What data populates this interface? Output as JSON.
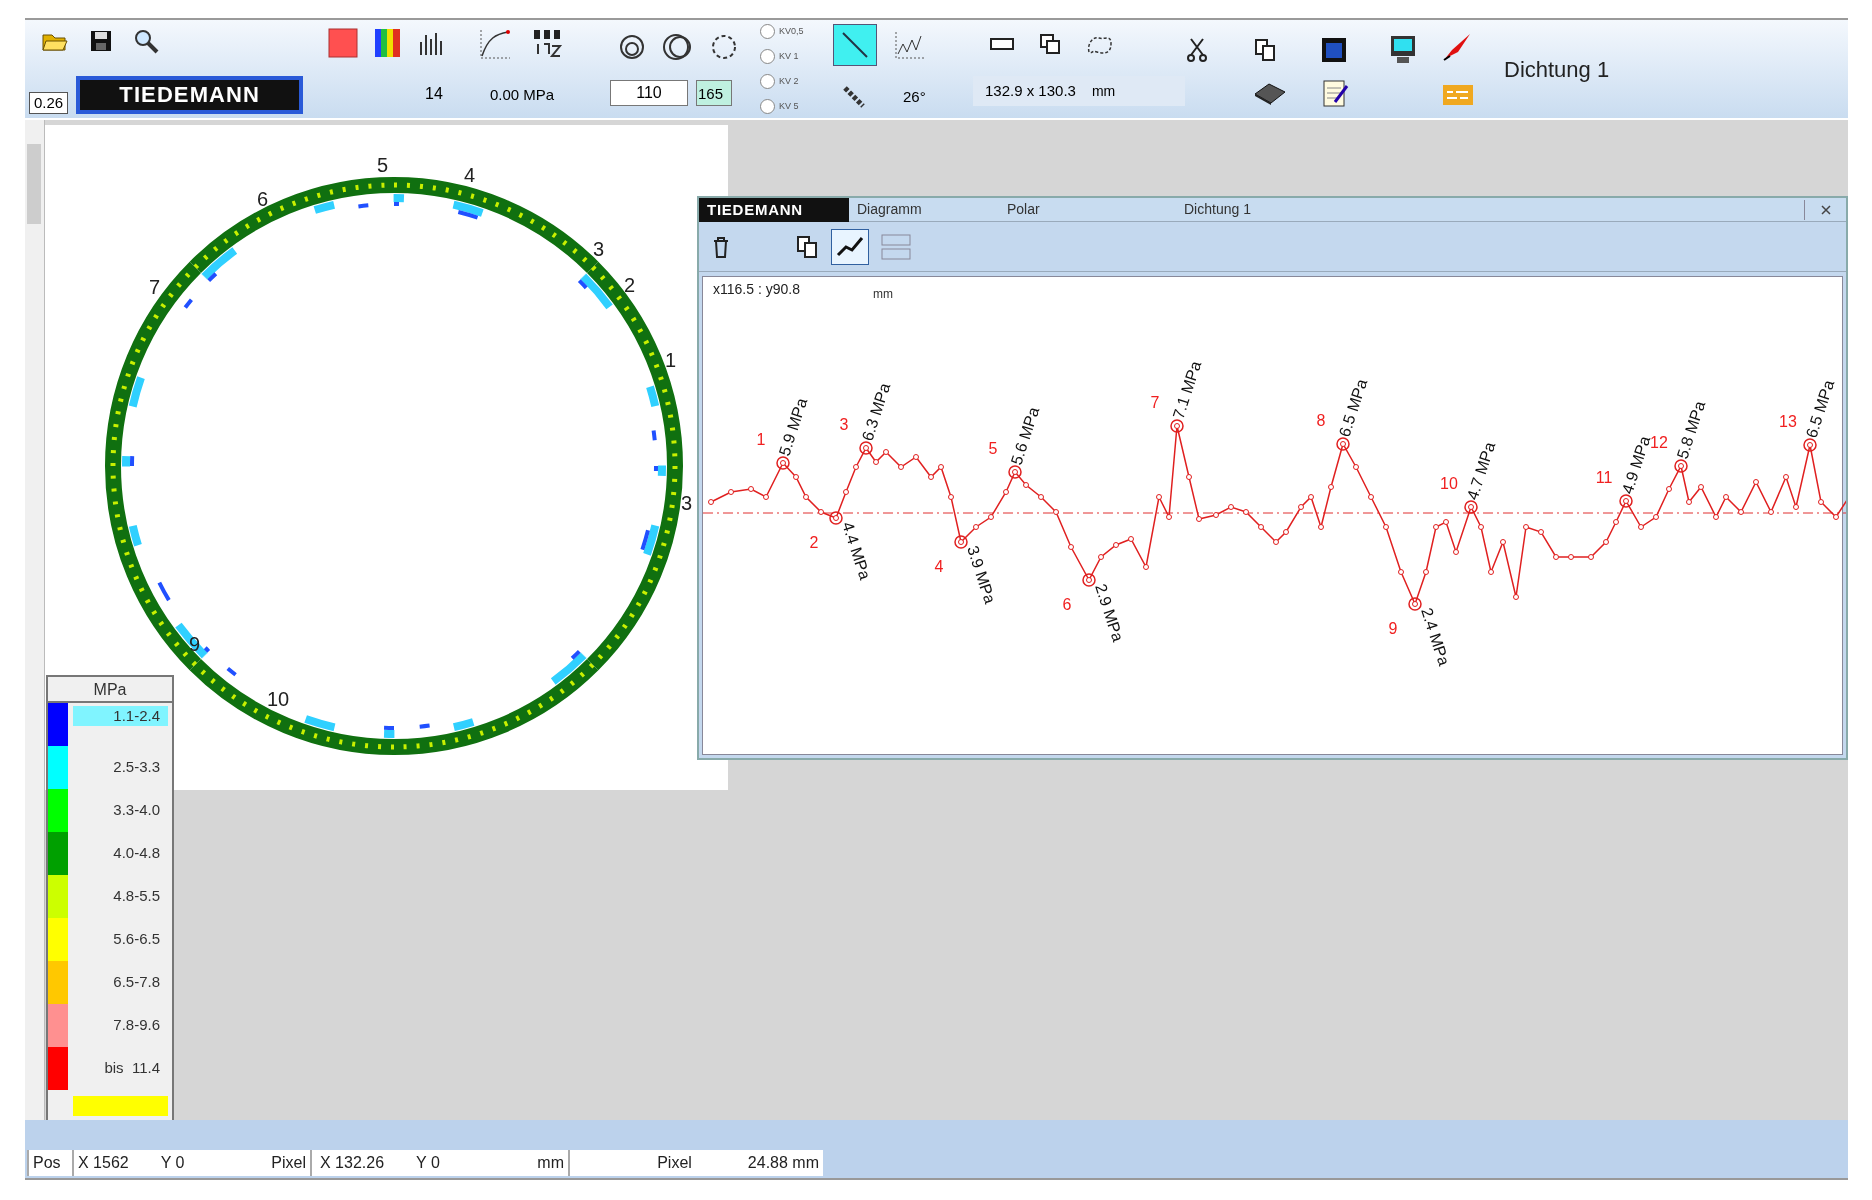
{
  "toolbar": {
    "zoom_value": "0.26",
    "logo": "TIEDEMANN",
    "count": "14",
    "pressure": "0.00 MPa",
    "threshold_value": "110",
    "threshold_value_2": "165",
    "radio_options": [
      {
        "label": "KV0,5",
        "selected": false
      },
      {
        "label": "KV 1",
        "selected": false
      },
      {
        "label": "KV 2",
        "selected": false
      },
      {
        "label": "KV 5",
        "selected": false
      }
    ],
    "line_tool": {
      "pressed": true
    },
    "angle": "26°",
    "dimensions": "132.9 x 130.3",
    "dimensions_unit": "mm",
    "title": "Dichtung 1"
  },
  "ring": {
    "labels": [
      "5",
      "4",
      "6",
      "3",
      "2",
      "7",
      "1",
      "3",
      "9",
      "10"
    ]
  },
  "legend": {
    "unit": "MPa",
    "items": [
      {
        "label": "1.1-2.4",
        "color": "#0000ff",
        "selected": true
      },
      {
        "label": "2.5-3.3",
        "color": "#00ffff",
        "selected": false
      },
      {
        "label": "3.3-4.0",
        "color": "#00ff00",
        "selected": false
      },
      {
        "label": "4.0-4.8",
        "color": "#00a000",
        "selected": false
      },
      {
        "label": "4.8-5.5",
        "color": "#ccff00",
        "selected": false
      },
      {
        "label": "5.6-6.5",
        "color": "#ffff00",
        "selected": false
      },
      {
        "label": "6.5-7.8",
        "color": "#ffc800",
        "selected": false
      },
      {
        "label": "7.8-9.6",
        "color": "#ff9090",
        "selected": false
      },
      {
        "label": "bis  11.4",
        "color": "#ff0000",
        "selected": false
      }
    ]
  },
  "diagram": {
    "logo": "TIEDEMANN",
    "tabs": [
      "Diagramm",
      "Polar"
    ],
    "title": "Dichtung 1",
    "chart_tool": {
      "pressed": true
    },
    "coordinates": "x116.5 : y90.8",
    "unit": "mm",
    "peaks": [
      {
        "number": "1",
        "value": "5.9 MPa",
        "kind": "max"
      },
      {
        "number": "2",
        "value": "4.4 MPa",
        "kind": "min"
      },
      {
        "number": "3",
        "value": "6.3 MPa",
        "kind": "max"
      },
      {
        "number": "4",
        "value": "3.9 MPa",
        "kind": "min"
      },
      {
        "number": "5",
        "value": "5.6 MPa",
        "kind": "max"
      },
      {
        "number": "6",
        "value": "2.9 MPa",
        "kind": "min"
      },
      {
        "number": "7",
        "value": "7.1 MPa",
        "kind": "max"
      },
      {
        "number": "8",
        "value": "6.5 MPa",
        "kind": "max"
      },
      {
        "number": "9",
        "value": "2.4 MPa",
        "kind": "min"
      },
      {
        "number": "10",
        "value": "4.7 MPa",
        "kind": "max"
      },
      {
        "number": "11",
        "value": "4.9 MPa",
        "kind": "max"
      },
      {
        "number": "12",
        "value": "5.8 MPa",
        "kind": "max"
      },
      {
        "number": "13",
        "value": "6.5 MPa",
        "kind": "max"
      }
    ]
  },
  "status_bar": {
    "pos_label": "Pos",
    "pixel_x": "X 1562",
    "pixel_y": "Y 0",
    "pixel_unit": "Pixel",
    "mm_x": "X 132.26",
    "mm_y": "Y 0",
    "mm_unit": "mm",
    "length_unit": "Pixel",
    "length": "24.88 mm"
  }
}
